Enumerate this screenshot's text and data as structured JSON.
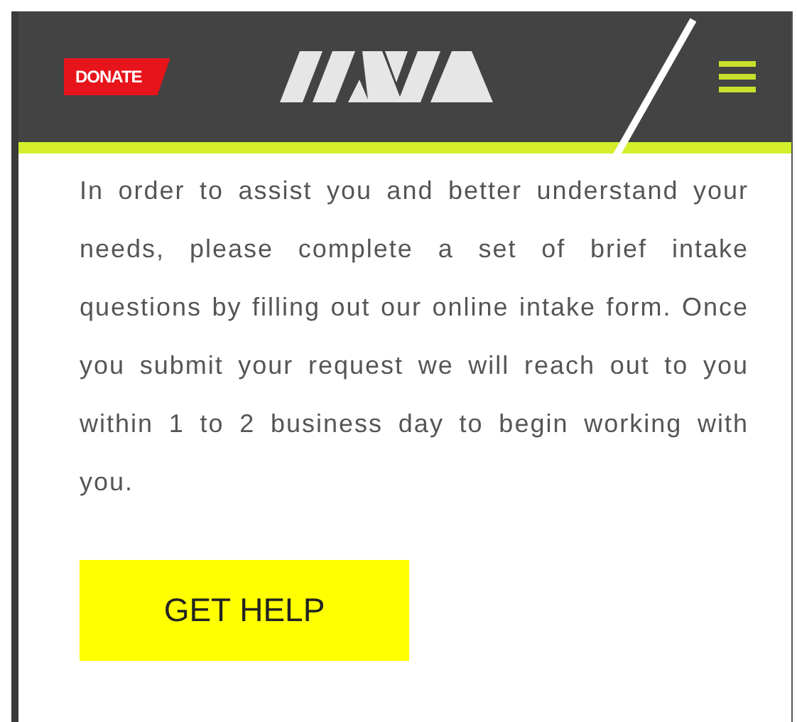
{
  "header": {
    "donate_label": "DONATE"
  },
  "intro": "In order to assist you and better understand your needs, please complete a set of brief intake questions by filling out our online intake form. Once you submit your request we will reach out to you within 1 to 2 business day to begin working with you.",
  "button": {
    "label": "GET HELP"
  }
}
